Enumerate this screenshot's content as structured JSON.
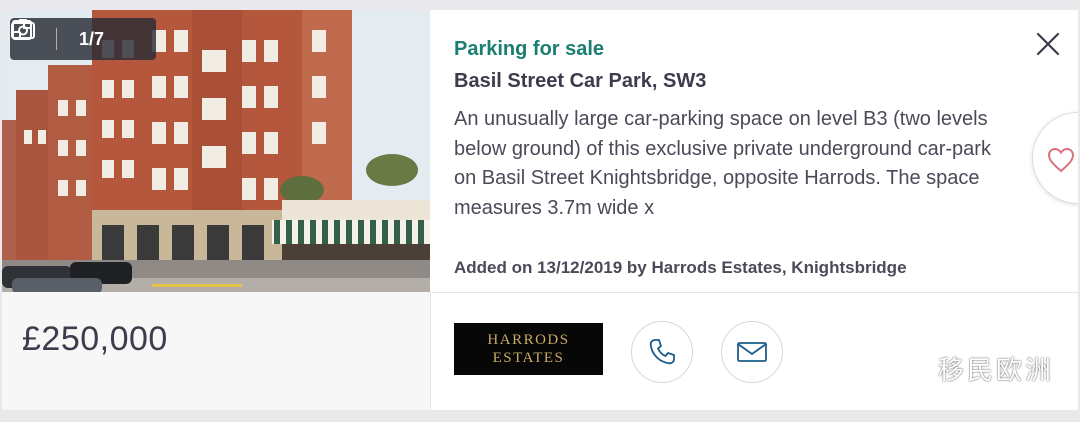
{
  "photo": {
    "alt": "Red-brick mansion blocks on Basil Street with striped shop awnings",
    "counter": "1/7"
  },
  "listing": {
    "type": "Parking for sale",
    "title": "Basil Street Car Park, SW3",
    "description": "An unusually large car-parking space on level B3 (two levels below ground) of this exclusive private underground car-park on Basil Street Knightsbridge, opposite Harrods. The space measures 3.7m wide x",
    "added_on": "Added on 13/12/2019 by Harrods Estates, Knightsbridge",
    "price": "£250,000"
  },
  "agent": {
    "logo_line1": "HARRODS",
    "logo_line2": "ESTATES"
  },
  "icons": {
    "floorplan": "floorplan-icon",
    "camera": "camera-icon",
    "close": "close-icon",
    "heart": "heart-icon",
    "phone": "phone-icon",
    "email": "email-icon",
    "wechat": "wechat-icon"
  },
  "watermark": {
    "text": "移民欧洲"
  },
  "colors": {
    "accent": "#1a7f71",
    "text": "#3d3c4c",
    "heart": "#d9727f",
    "contact_icon": "#1a5d8c",
    "logo_gold": "#c9a968"
  }
}
